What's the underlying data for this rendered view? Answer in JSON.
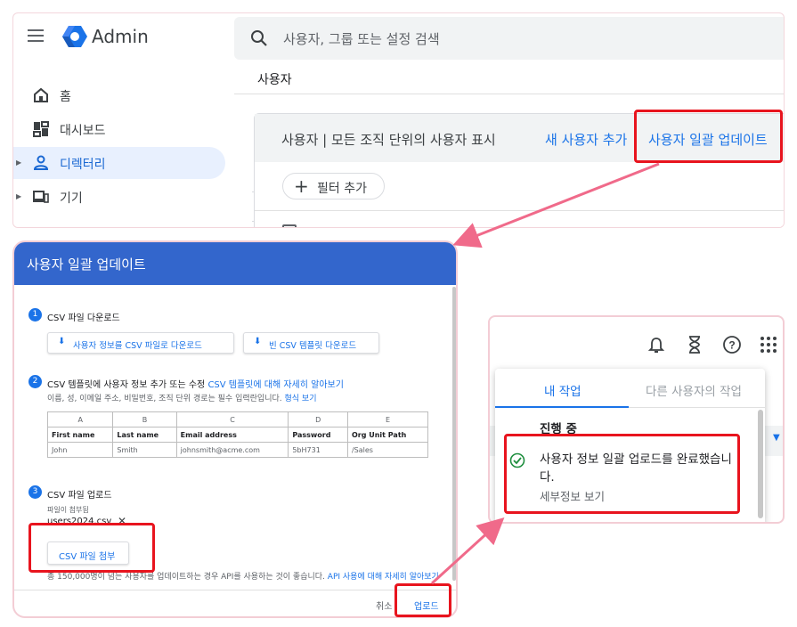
{
  "app": {
    "title": "Admin",
    "search_placeholder": "사용자, 그룹 또는 설정 검색",
    "breadcrumb": "사용자"
  },
  "sidebar": {
    "items": [
      {
        "label": "홈",
        "icon": "home-icon",
        "active": false
      },
      {
        "label": "대시보드",
        "icon": "dashboard-icon",
        "active": false
      },
      {
        "label": "디렉터리",
        "icon": "person-icon",
        "active": true
      },
      {
        "label": "기기",
        "icon": "devices-icon",
        "active": false
      }
    ]
  },
  "users_card": {
    "heading": "사용자 | 모든 조직 단위의 사용자 표시",
    "add_user": "새 사용자 추가",
    "bulk_update": "사용자 일괄 업데이트",
    "add_filter": "필터 추가"
  },
  "dialog": {
    "title": "사용자 일괄 업데이트",
    "step1": {
      "num": "1",
      "text": "CSV 파일 다운로드",
      "btn_download_users": "사용자 정보를 CSV 파일로 다운로드",
      "btn_download_template": "빈 CSV 템플릿 다운로드"
    },
    "step2": {
      "num": "2",
      "text": "CSV 템플릿에 사용자 정보 추가 또는 수정",
      "link": "CSV 템플릿에 대해 자세히 알아보기",
      "note": "이름, 성, 이메일 주소, 비밀번호, 조직 단위 경로는 필수 입력란입니다.",
      "note_link": "형식 보기"
    },
    "table": {
      "letters": [
        "A",
        "B",
        "C",
        "D",
        "E"
      ],
      "headers": [
        "First name",
        "Last name",
        "Email address",
        "Password",
        "Org Unit Path"
      ],
      "rows": [
        [
          "John",
          "Smith",
          "johnsmith@acme.com",
          "5bH731",
          "/Sales"
        ]
      ]
    },
    "step3": {
      "num": "3",
      "text": "CSV 파일 업로드",
      "attached_label": "파일이 첨부됨",
      "file_name": "users2024.csv",
      "attach_btn": "CSV 파일 첨부"
    },
    "footer_note_prefix": "총 150,000명이 넘는 사용자를 업데이트하는 경우 API를 사용하는 것이 좋습니다.",
    "footer_note_link": "API 사용에 대해 자세히 알아보기",
    "cancel": "취소",
    "upload": "업로드"
  },
  "tasks": {
    "tab_mine": "내 작업",
    "tab_others": "다른 사용자의 작업",
    "in_progress": "진행 중",
    "message": "사용자 정보 일괄 업로드를 완료했습니다.",
    "details": "세부정보 보기"
  },
  "colors": {
    "accent": "#1a73e8",
    "dialog_header": "#3366cc",
    "highlight": "#e8141e",
    "arrow": "#f06a8a"
  }
}
